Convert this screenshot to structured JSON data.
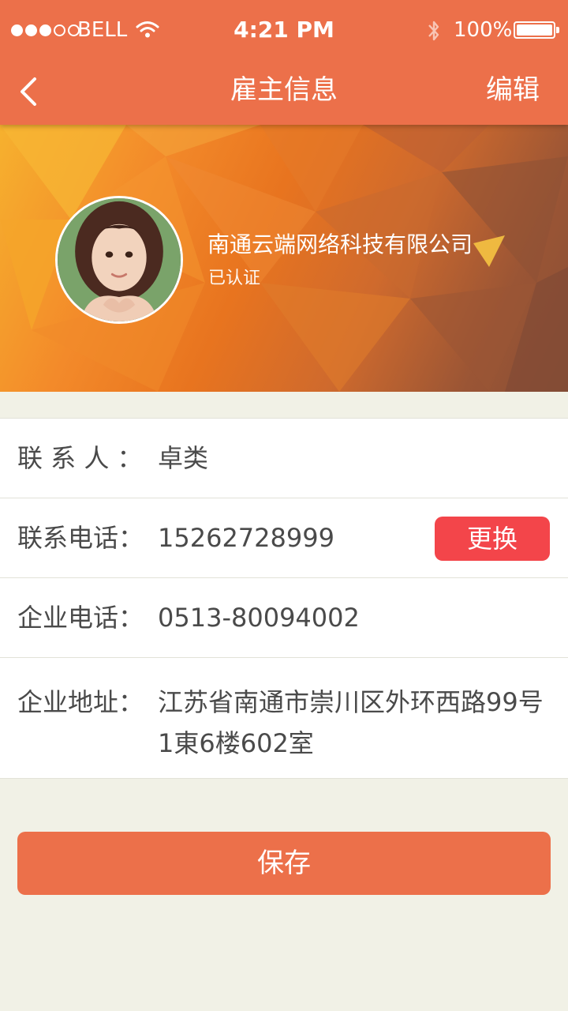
{
  "status_bar": {
    "carrier": "BELL",
    "time": "4:21 PM",
    "battery": "100%",
    "signal_bars_filled": 3,
    "signal_bars_total": 5
  },
  "nav": {
    "title": "雇主信息",
    "edit_label": "编辑",
    "back_icon": "chevron-left-icon"
  },
  "profile": {
    "company_name": "南通云端网络科技有限公司",
    "verified_label": "已认证"
  },
  "info": {
    "contact_label": "联 系 人 ：",
    "contact_value": "卓类",
    "phone_label": "联系电话：",
    "phone_value": "15262728999",
    "change_label": "更换",
    "company_phone_label": "企业电话：",
    "company_phone_value": "0513-80094002",
    "address_label": "企业地址：",
    "address_value": "江苏省南通市崇川区外环西路99号1東6楼602室"
  },
  "actions": {
    "save_label": "保存"
  },
  "colors": {
    "accent": "#ec704a",
    "change_button": "#f3454a",
    "background": "#f1f1e6"
  }
}
